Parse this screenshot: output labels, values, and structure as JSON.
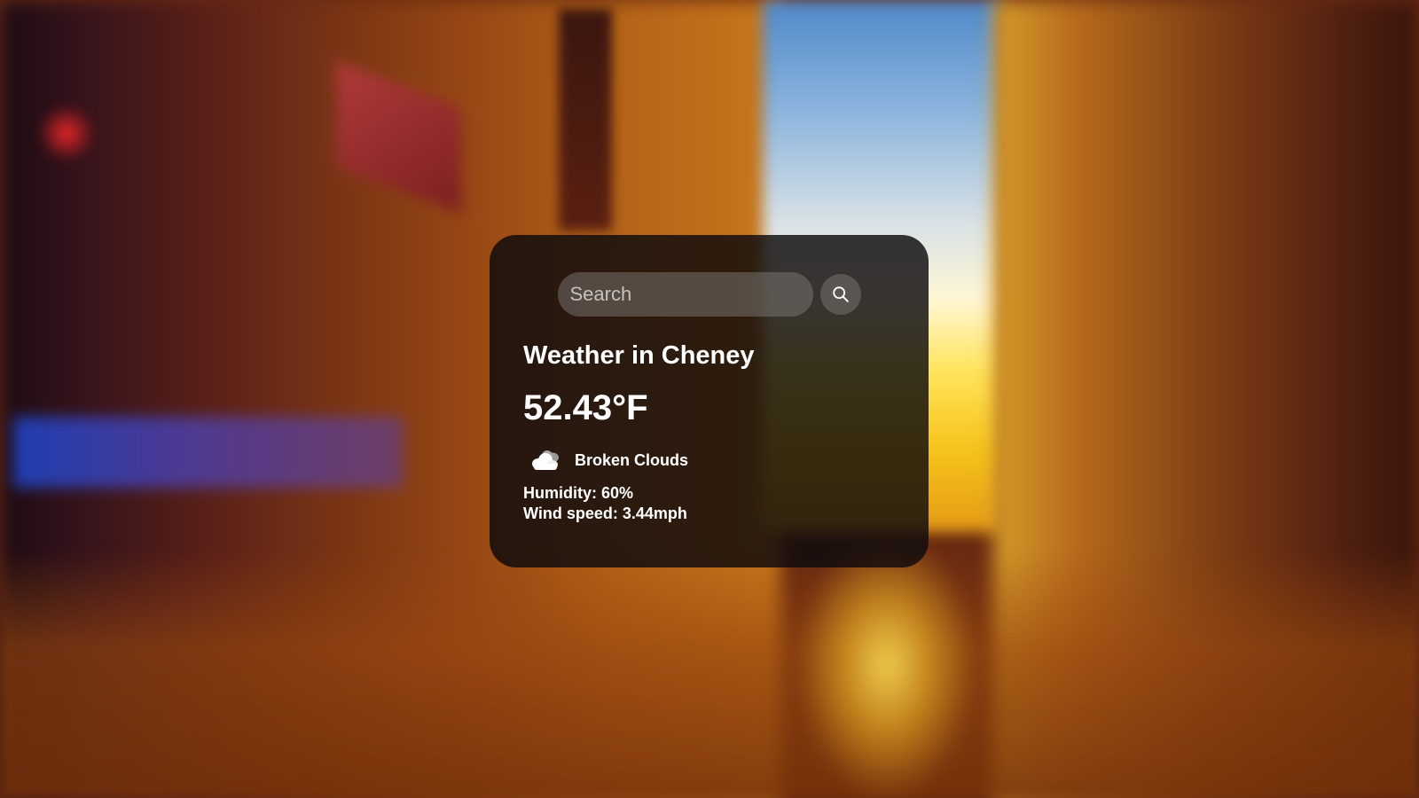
{
  "colors": {
    "card_background": "rgba(12,10,12,0.82)",
    "text": "#ffffff",
    "search_field": "rgba(120,114,110,0.55)",
    "search_button": "rgba(110,104,100,0.65)"
  },
  "background": {
    "type": "blurred-photo",
    "subject": "sunset-city-street"
  },
  "search": {
    "placeholder": "Search",
    "value": "",
    "button_icon": "search-icon"
  },
  "weather": {
    "title": "Weather in Cheney",
    "temperature": "52.43°F",
    "condition_icon": "cloud-icon",
    "condition": "Broken Clouds",
    "humidity": "Humidity: 60%",
    "wind": "Wind speed: 3.44mph"
  }
}
